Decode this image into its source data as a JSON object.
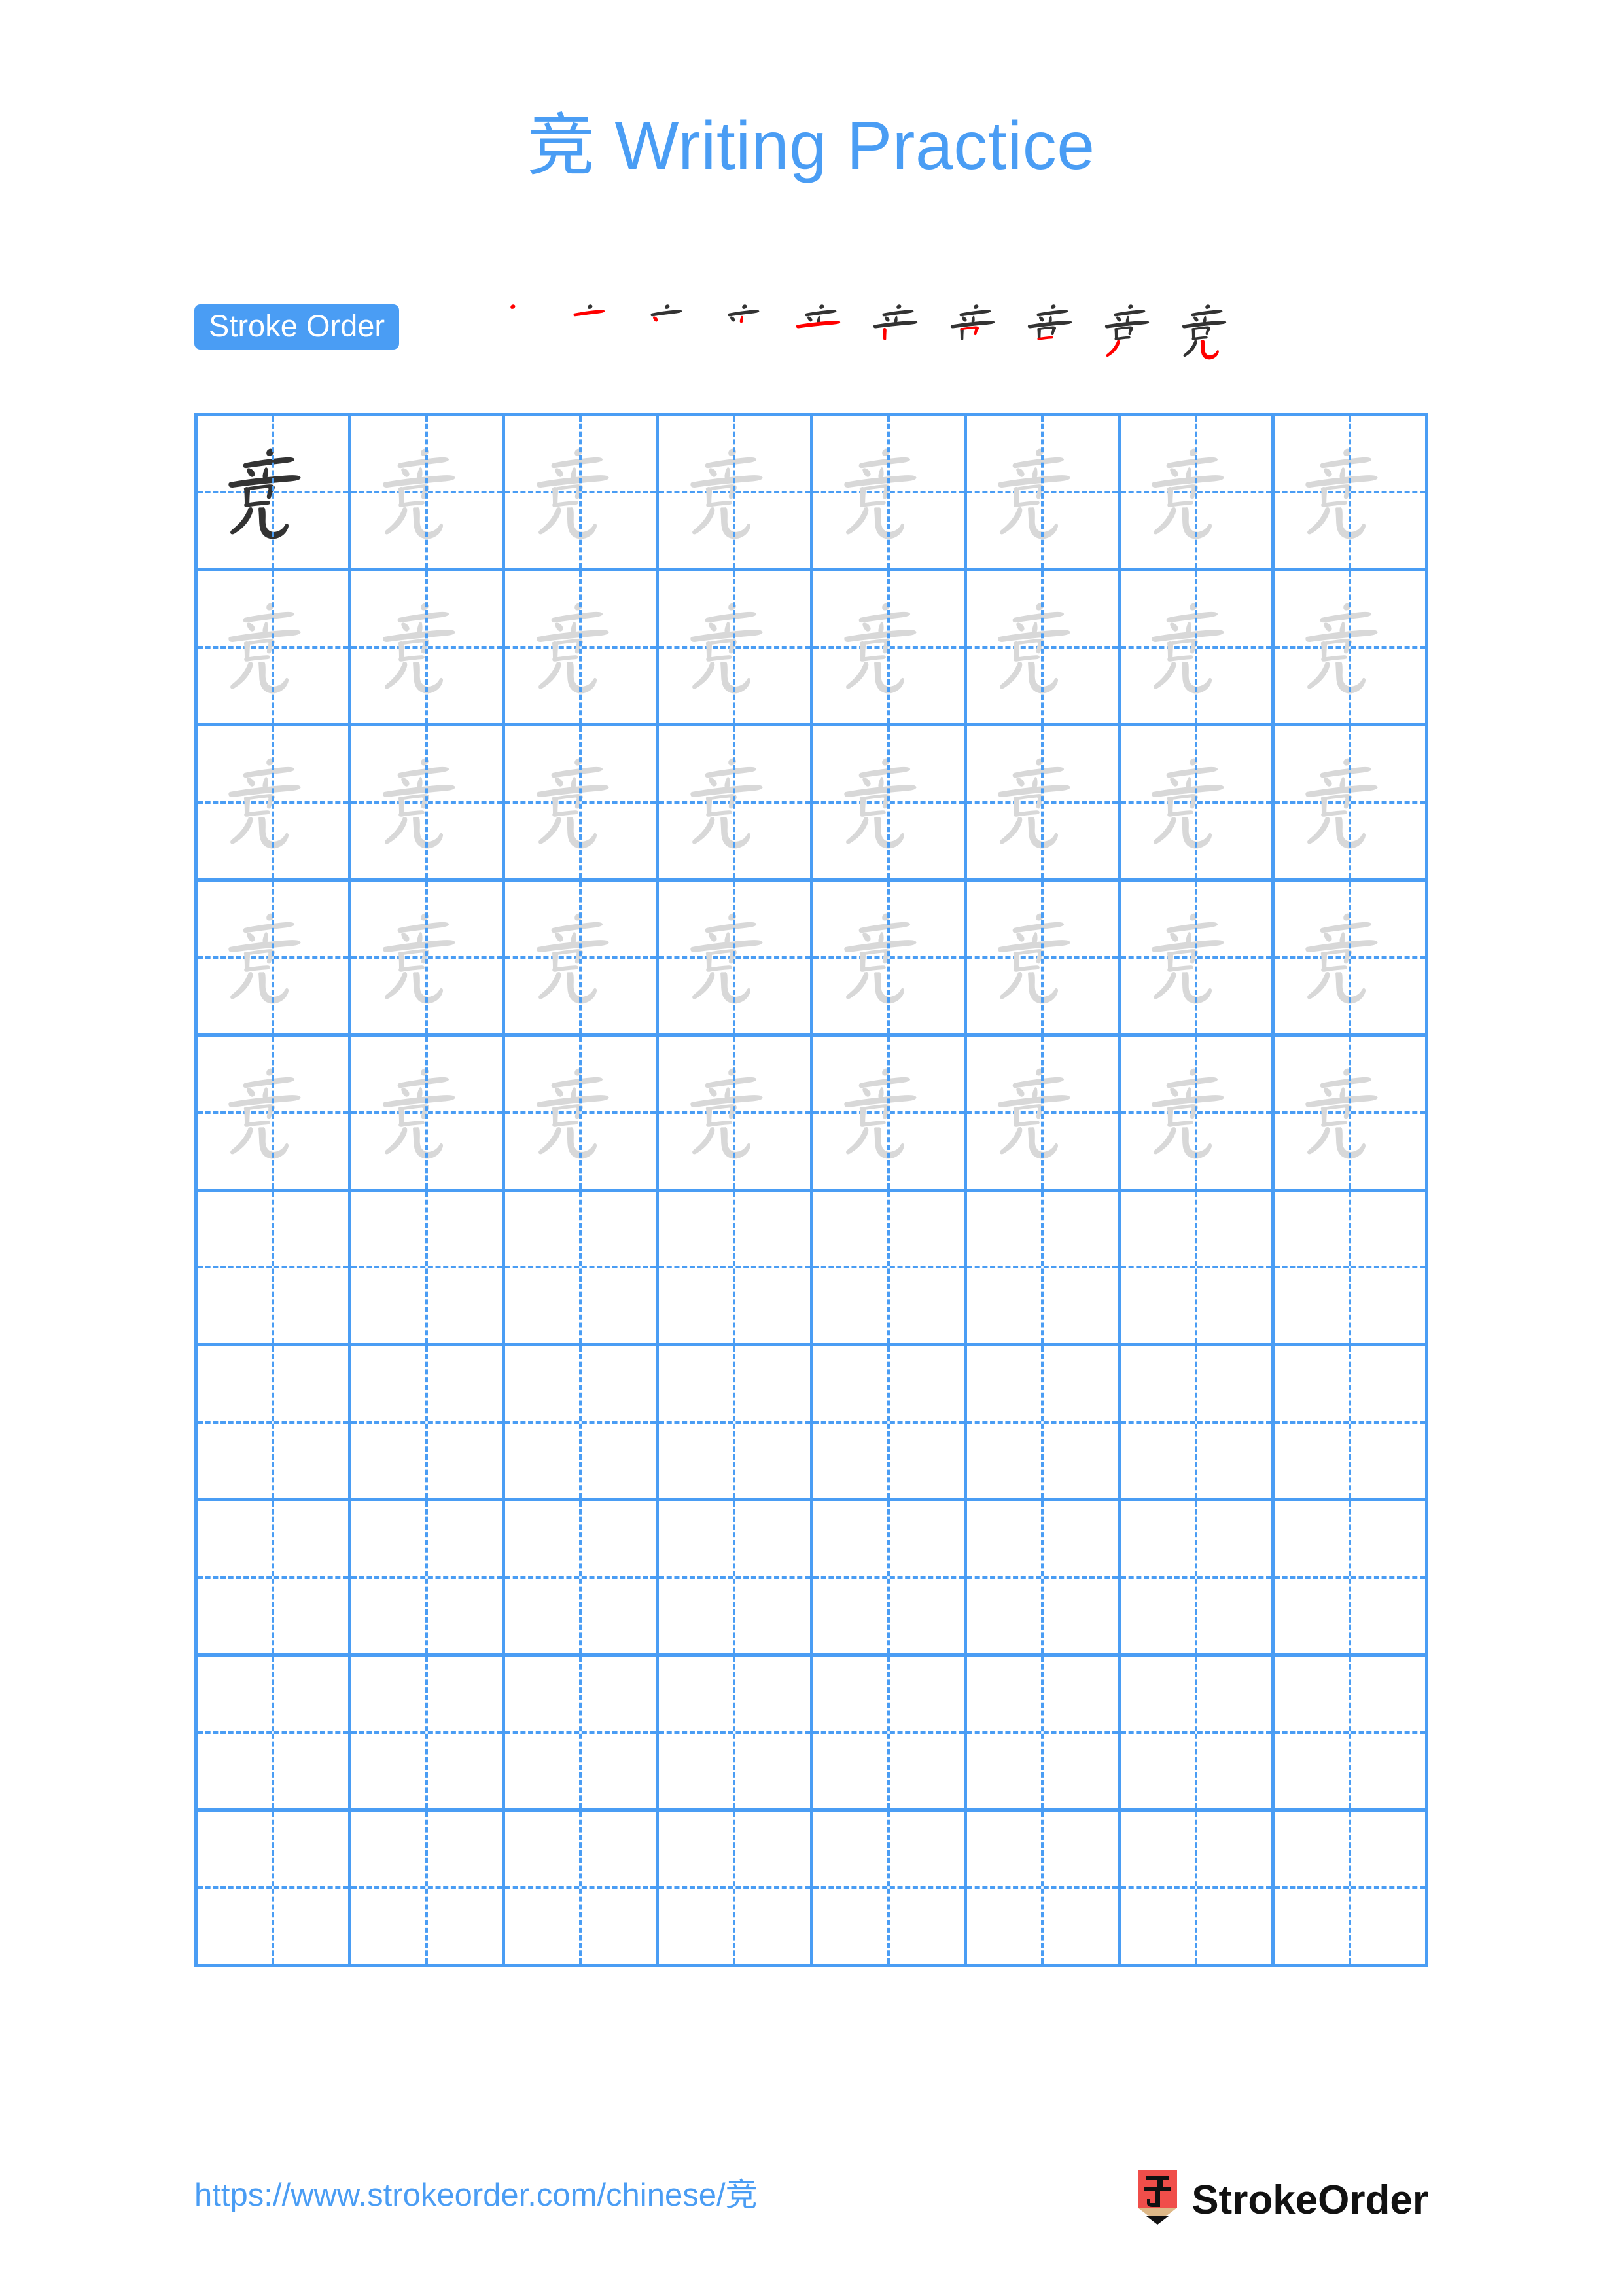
{
  "page": {
    "background_color": "#ffffff",
    "accent_color": "#4a9df4",
    "ink_dark_color": "#333333",
    "ink_light_color": "#d8d8d8",
    "stroke_highlight_color": "#ff0000"
  },
  "header": {
    "character": "竞",
    "title_suffix": " Writing Practice",
    "full_title": "竞 Writing Practice"
  },
  "stroke_order": {
    "badge_label": "Stroke Order",
    "character": "竞",
    "total_strokes": 10,
    "steps": [
      {
        "index": 1,
        "strokes_shown": 1,
        "new_stroke_color": "#ff0000"
      },
      {
        "index": 2,
        "strokes_shown": 2,
        "new_stroke_color": "#ff0000"
      },
      {
        "index": 3,
        "strokes_shown": 3,
        "new_stroke_color": "#ff0000"
      },
      {
        "index": 4,
        "strokes_shown": 4,
        "new_stroke_color": "#ff0000"
      },
      {
        "index": 5,
        "strokes_shown": 5,
        "new_stroke_color": "#ff0000"
      },
      {
        "index": 6,
        "strokes_shown": 6,
        "new_stroke_color": "#ff0000"
      },
      {
        "index": 7,
        "strokes_shown": 7,
        "new_stroke_color": "#ff0000"
      },
      {
        "index": 8,
        "strokes_shown": 8,
        "new_stroke_color": "#ff0000"
      },
      {
        "index": 9,
        "strokes_shown": 9,
        "new_stroke_color": "#ff0000"
      },
      {
        "index": 10,
        "strokes_shown": 10,
        "new_stroke_color": "#ff0000"
      }
    ]
  },
  "practice_grid": {
    "columns": 8,
    "rows": 10,
    "cell_style": "tian-zi-ge",
    "character": "竞",
    "rows_data": [
      {
        "row": 1,
        "cells": [
          "dark",
          "light",
          "light",
          "light",
          "light",
          "light",
          "light",
          "light"
        ]
      },
      {
        "row": 2,
        "cells": [
          "light",
          "light",
          "light",
          "light",
          "light",
          "light",
          "light",
          "light"
        ]
      },
      {
        "row": 3,
        "cells": [
          "light",
          "light",
          "light",
          "light",
          "light",
          "light",
          "light",
          "light"
        ]
      },
      {
        "row": 4,
        "cells": [
          "light",
          "light",
          "light",
          "light",
          "light",
          "light",
          "light",
          "light"
        ]
      },
      {
        "row": 5,
        "cells": [
          "light",
          "light",
          "light",
          "light",
          "light",
          "light",
          "light",
          "light"
        ]
      },
      {
        "row": 6,
        "cells": [
          "empty",
          "empty",
          "empty",
          "empty",
          "empty",
          "empty",
          "empty",
          "empty"
        ]
      },
      {
        "row": 7,
        "cells": [
          "empty",
          "empty",
          "empty",
          "empty",
          "empty",
          "empty",
          "empty",
          "empty"
        ]
      },
      {
        "row": 8,
        "cells": [
          "empty",
          "empty",
          "empty",
          "empty",
          "empty",
          "empty",
          "empty",
          "empty"
        ]
      },
      {
        "row": 9,
        "cells": [
          "empty",
          "empty",
          "empty",
          "empty",
          "empty",
          "empty",
          "empty",
          "empty"
        ]
      },
      {
        "row": 10,
        "cells": [
          "empty",
          "empty",
          "empty",
          "empty",
          "empty",
          "empty",
          "empty",
          "empty"
        ]
      }
    ]
  },
  "footer": {
    "url": "https://www.strokeorder.com/chinese/竞",
    "logo_text": "StrokeOrder",
    "logo_character": "字",
    "logo_body_color": "#f04e4a",
    "logo_wood_color": "#deb887",
    "logo_tip_color": "#111111"
  }
}
